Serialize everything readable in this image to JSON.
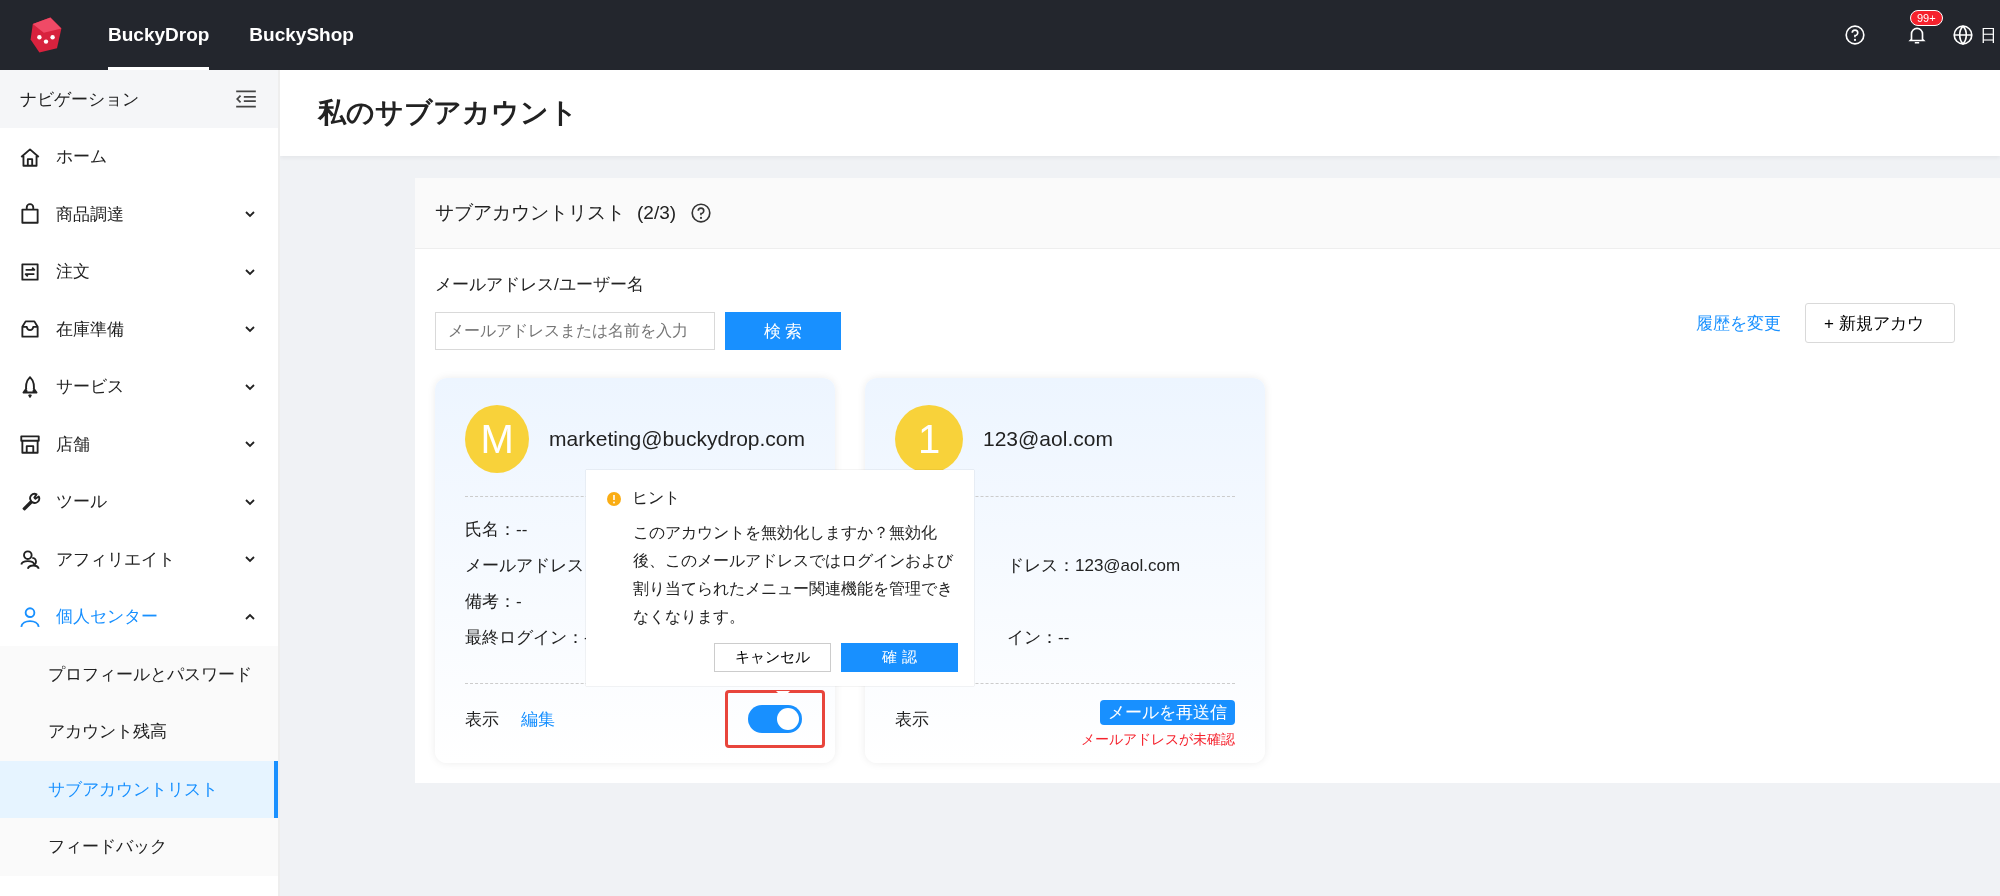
{
  "topbar": {
    "tabs": [
      {
        "label": "BuckyDrop",
        "selected": true
      },
      {
        "label": "BuckyShop",
        "selected": false
      }
    ],
    "notification_badge": "99+",
    "language": "日"
  },
  "sidebar": {
    "title": "ナビゲーション",
    "items": [
      {
        "label": "ホーム"
      },
      {
        "label": "商品調達",
        "expanded": false
      },
      {
        "label": "注文",
        "expanded": false
      },
      {
        "label": "在庫準備",
        "expanded": false
      },
      {
        "label": "サービス",
        "expanded": false
      },
      {
        "label": "店舗",
        "expanded": false
      },
      {
        "label": "ツール",
        "expanded": false
      },
      {
        "label": "アフィリエイト",
        "expanded": false
      },
      {
        "label": "個人センター",
        "expanded": true,
        "children": [
          {
            "label": "プロフィールとパスワード",
            "selected": false
          },
          {
            "label": "アカウント残高",
            "selected": false
          },
          {
            "label": "サブアカウントリスト",
            "selected": true
          },
          {
            "label": "フィードバック",
            "selected": false
          }
        ]
      }
    ]
  },
  "page_title": "私のサブアカウント",
  "panel": {
    "title": "サブアカウントリスト",
    "count": "(2/3)",
    "search_label": "メールアドレス/ユーザー名",
    "search": {
      "placeholder": "メールアドレスまたは名前を入力"
    },
    "search_button": "検 索",
    "history_link": "履歴を変更",
    "new_button": "+ 新規アカウ",
    "cards": [
      {
        "initial": "M",
        "email": "marketing@buckydrop.com",
        "covered": false,
        "fields": [
          {
            "text": "氏名：--"
          },
          {
            "text": "メールアドレス"
          },
          {
            "text": "備考：-"
          },
          {
            "text": "最終ログイン：-"
          }
        ],
        "view": "表示",
        "edit": "編集",
        "enabled": true,
        "highlighted": true
      },
      {
        "initial": "1",
        "email": "123@aol.com",
        "covered": true,
        "fields": [
          {
            "text": "ドレス：123@aol.com"
          },
          {
            "text": "イン：--"
          }
        ],
        "view": "表示",
        "resend": "メールを再送信",
        "warning": "メールアドレスが未確認"
      }
    ]
  },
  "popconfirm": {
    "title": "ヒント",
    "message": "このアカウントを無効化しますか？無効化後、このメールアドレスではログインおよび割り当てられたメニュー関連機能を管理できなくなります。",
    "cancel": "キャンセル",
    "confirm": "確 認"
  }
}
